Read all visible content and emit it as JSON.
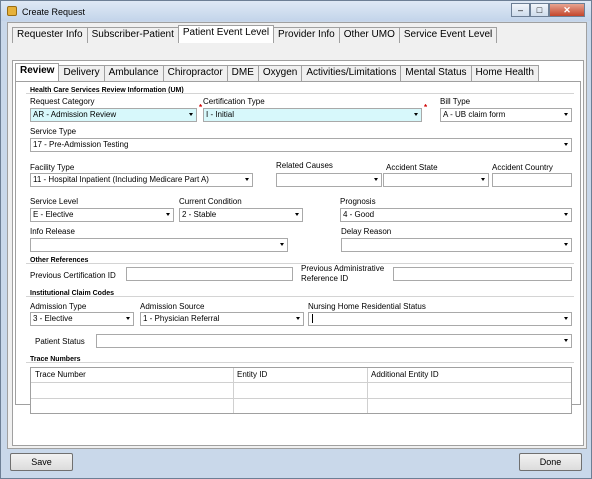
{
  "window": {
    "title": "Create Request",
    "minimize_glyph": "–",
    "maximize_glyph": "□",
    "close_glyph": "✕"
  },
  "outer_tabs": [
    "Requester Info",
    "Subscriber-Patient",
    "Patient Event Level",
    "Provider Info",
    "Other UMO",
    "Service Event Level"
  ],
  "inner_tabs": [
    "Review",
    "Delivery",
    "Ambulance",
    "Chiropractor",
    "DME",
    "Oxygen",
    "Activities/Limitations",
    "Mental Status",
    "Home Health"
  ],
  "um": {
    "group_title": "Health Care Services Review Information (UM)",
    "request_category": {
      "label": "Request Category",
      "value": "AR - Admission Review"
    },
    "certification_type": {
      "label": "Certification Type",
      "value": "I - Initial"
    },
    "bill_type": {
      "label": "Bill Type",
      "value": "A - UB claim form"
    },
    "service_type": {
      "label": "Service Type",
      "value": "17 - Pre-Admission Testing"
    },
    "facility_type": {
      "label": "Facility Type",
      "value": "11 - Hospital Inpatient (Including Medicare Part A)"
    },
    "related_causes": {
      "label": "Related Causes",
      "value": ""
    },
    "accident_state": {
      "label": "Accident State",
      "value": ""
    },
    "accident_country": {
      "label": "Accident Country",
      "value": ""
    },
    "service_level": {
      "label": "Service Level",
      "value": "E - Elective"
    },
    "current_condition": {
      "label": "Current Condition",
      "value": "2 - Stable"
    },
    "prognosis": {
      "label": "Prognosis",
      "value": "4 - Good"
    },
    "info_release": {
      "label": "Info Release",
      "value": ""
    },
    "delay_reason": {
      "label": "Delay Reason",
      "value": ""
    },
    "required_mark": "*"
  },
  "other_refs": {
    "group_title": "Other References",
    "prev_cert_label": "Previous Certification ID",
    "prev_cert_value": "",
    "prev_admin_label_1": "Previous Administrative",
    "prev_admin_label_2": "Reference ID",
    "prev_admin_value": ""
  },
  "institutional": {
    "group_title": "Institutional Claim Codes",
    "admission_type": {
      "label": "Admission Type",
      "value": "3 - Elective"
    },
    "admission_source": {
      "label": "Admission Source",
      "value": "1 - Physician Referral"
    },
    "nursing_home": {
      "label": "Nursing Home Residential Status",
      "value": ""
    },
    "patient_status": {
      "label": "Patient Status",
      "value": ""
    }
  },
  "trace": {
    "group_title": "Trace Numbers",
    "columns": [
      "Trace Number",
      "Entity ID",
      "Additional Entity ID"
    ]
  },
  "buttons": {
    "save": "Save",
    "done": "Done"
  }
}
